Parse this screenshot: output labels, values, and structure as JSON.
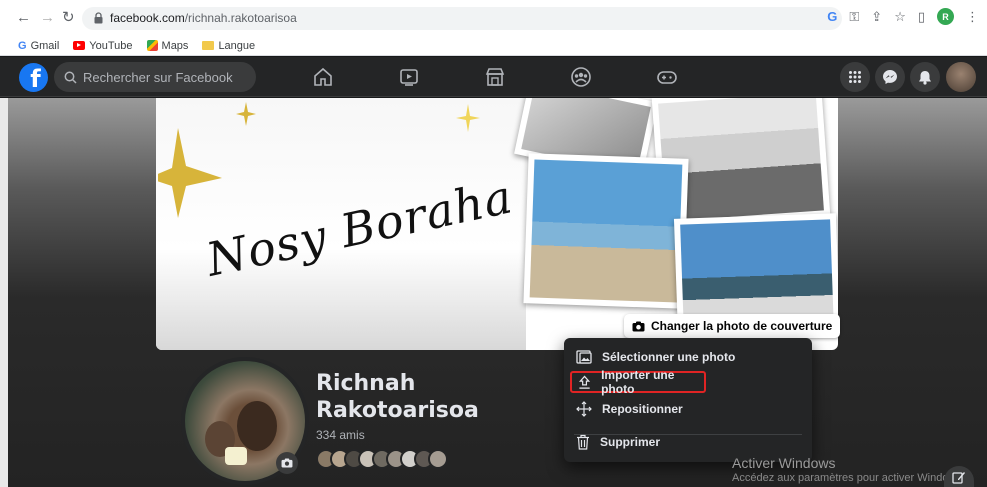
{
  "browser": {
    "url_host": "facebook.com",
    "url_path": "/richnah.rakotoarisoa",
    "bookmarks": [
      {
        "label": "Gmail"
      },
      {
        "label": "YouTube"
      },
      {
        "label": "Maps"
      },
      {
        "label": "Langue"
      }
    ],
    "profile_initial": "R"
  },
  "header": {
    "search_placeholder": "Rechercher sur Facebook",
    "logo_letter": "f"
  },
  "cover": {
    "title": "Nosy Boraha",
    "change_button": "Changer la photo de couverture"
  },
  "menu": {
    "items": [
      {
        "label": "Sélectionner une photo",
        "icon": "photo-select-icon"
      },
      {
        "label": "Importer une photo",
        "icon": "upload-icon"
      },
      {
        "label": "Repositionner",
        "icon": "move-arrows-icon"
      },
      {
        "label": "Supprimer",
        "icon": "trash-icon"
      }
    ]
  },
  "profile": {
    "name_line1": "Richnah",
    "name_line2": "Rakotoarisoa",
    "friends": "334 amis"
  },
  "watermark": {
    "title": "Activer Windows",
    "subtitle": "Accédez aux paramètres pour activer Windows."
  },
  "colors": {
    "fb_blue": "#1877f2",
    "highlight_red": "#e02424",
    "header_bg": "#242526"
  }
}
